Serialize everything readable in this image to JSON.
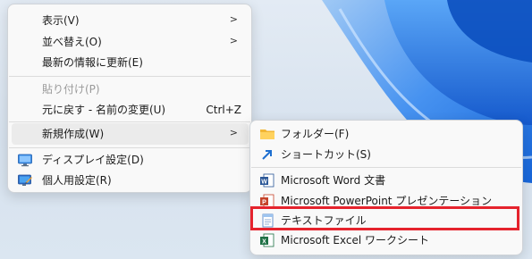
{
  "context_menu": {
    "items": [
      {
        "label": "表示(V)"
      },
      {
        "label": "並べ替え(O)"
      },
      {
        "label": "最新の情報に更新(E)"
      },
      {
        "label": "貼り付け(P)"
      },
      {
        "label": "元に戻す - 名前の変更(U)",
        "shortcut": "Ctrl+Z"
      },
      {
        "label": "新規作成(W)"
      },
      {
        "label": "ディスプレイ設定(D)",
        "icon": "display-icon"
      },
      {
        "label": "個人用設定(R)",
        "icon": "personalize-icon"
      }
    ]
  },
  "new_submenu": {
    "items": [
      {
        "label": "フォルダー(F)",
        "icon": "folder-icon"
      },
      {
        "label": "ショートカット(S)",
        "icon": "shortcut-arrow-icon"
      },
      {
        "label": "Microsoft Word 文書",
        "icon": "word-icon"
      },
      {
        "label": "Microsoft PowerPoint プレゼンテーション",
        "icon": "powerpoint-icon"
      },
      {
        "label": "テキストファイル",
        "icon": "text-file-icon"
      },
      {
        "label": "Microsoft Excel ワークシート",
        "icon": "excel-icon"
      }
    ]
  },
  "colors": {
    "highlight_border": "#e5232d",
    "menu_bg": "#f9f9f9",
    "wallpaper_accent": "#1f6fe0"
  }
}
